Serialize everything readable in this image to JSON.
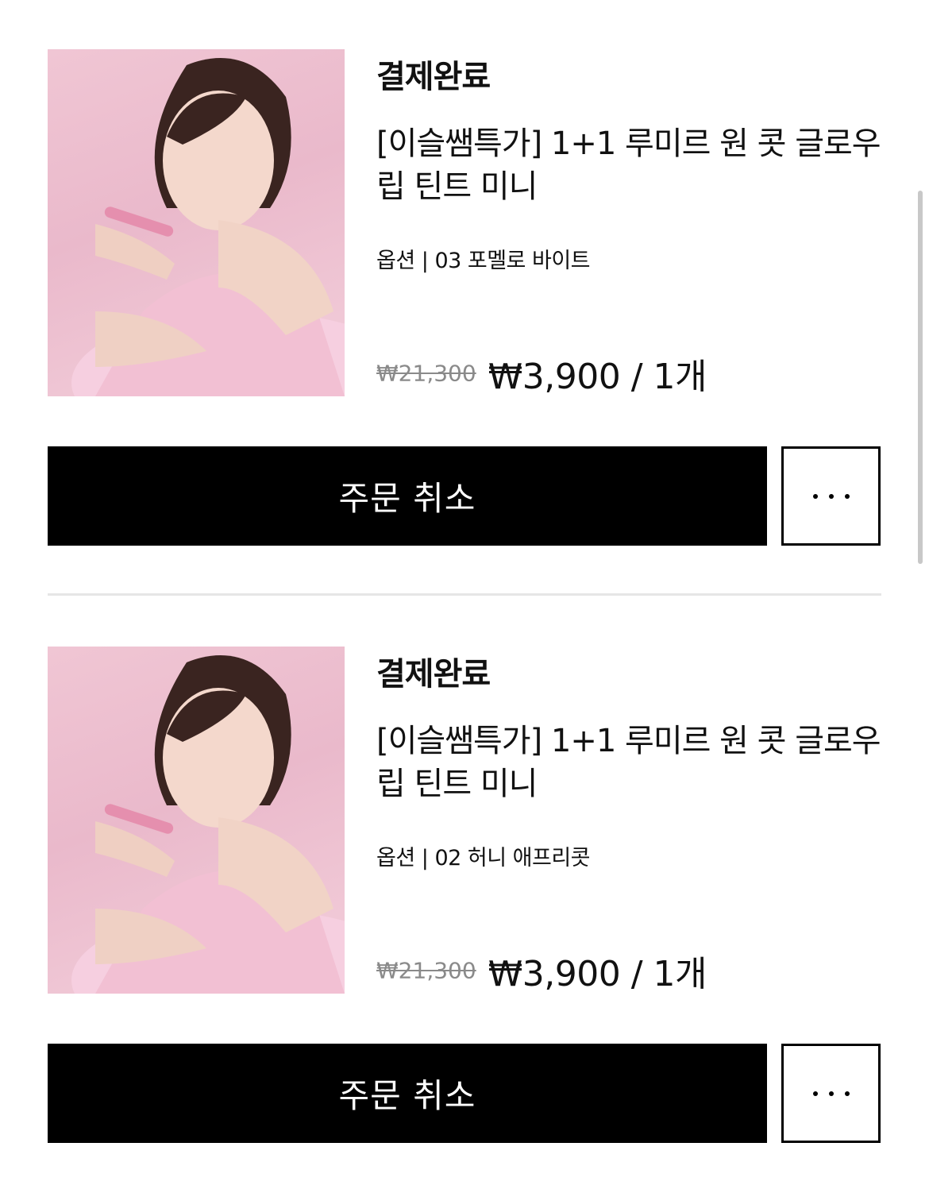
{
  "orders": [
    {
      "status": "결제완료",
      "product_title": "[이슬쌤특가] 1+1 루미르 원 콧 글로우 립 틴트 미니",
      "option_text": "옵션 | 03 포멜로 바이트",
      "original_price": "₩21,300",
      "final_price": "₩3,900 / 1개",
      "cancel_label": "주문 취소",
      "more_icon": "more-horizontal-icon"
    },
    {
      "status": "결제완료",
      "product_title": "[이슬쌤특가] 1+1 루미르 원 콧 글로우 립 틴트 미니",
      "option_text": "옵션 | 02 허니 애프리콧",
      "original_price": "₩21,300",
      "final_price": "₩3,900 / 1개",
      "cancel_label": "주문 취소",
      "more_icon": "more-horizontal-icon"
    }
  ],
  "colors": {
    "button_bg": "#000000",
    "button_text": "#ffffff",
    "strike_price": "#8a8a8a",
    "divider": "#e6e6e6",
    "thumb_bg": "#f0c6d4"
  }
}
